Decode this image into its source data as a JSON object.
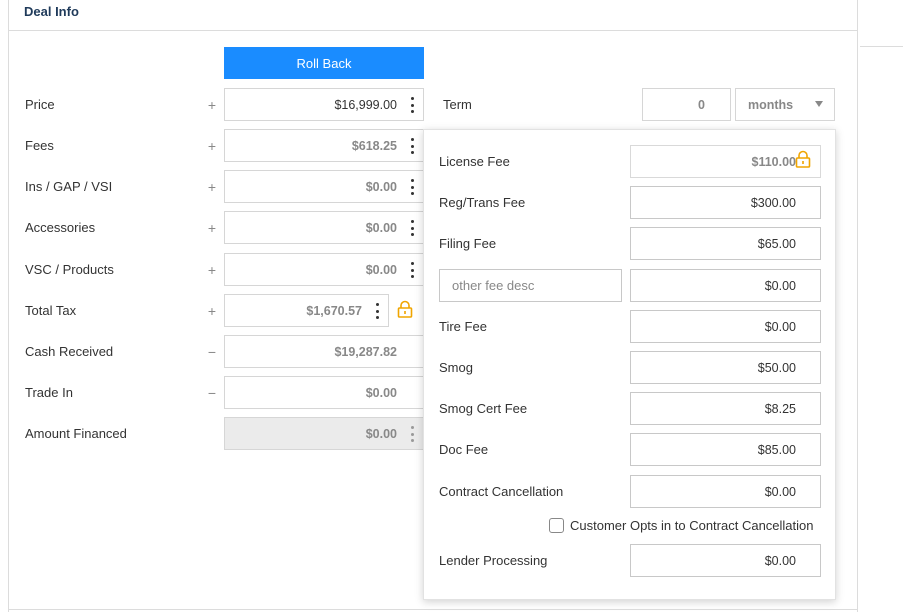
{
  "panel": {
    "title": "Deal Info"
  },
  "rollback_label": "Roll Back",
  "rows": {
    "price": {
      "label": "Price",
      "op": "+",
      "value": "$16,999.00"
    },
    "fees": {
      "label": "Fees",
      "op": "+",
      "value": "$618.25"
    },
    "ins": {
      "label": "Ins / GAP / VSI",
      "op": "+",
      "value": "$0.00"
    },
    "accessories": {
      "label": "Accessories",
      "op": "+",
      "value": "$0.00"
    },
    "vsc": {
      "label": "VSC / Products",
      "op": "+",
      "value": "$0.00"
    },
    "tax": {
      "label": "Total Tax",
      "op": "+",
      "value": "$1,670.57"
    },
    "cash": {
      "label": "Cash Received",
      "op": "−",
      "value": "$19,287.82"
    },
    "trade": {
      "label": "Trade In",
      "op": "−",
      "value": "$0.00"
    },
    "financed": {
      "label": "Amount Financed",
      "value": "$0.00"
    }
  },
  "term": {
    "label": "Term",
    "value": "0",
    "unit": "months"
  },
  "fees_popover": {
    "license": {
      "label": "License Fee",
      "value": "$110.00"
    },
    "reg": {
      "label": "Reg/Trans Fee",
      "value": "$300.00"
    },
    "filing": {
      "label": "Filing Fee",
      "value": "$65.00"
    },
    "other": {
      "placeholder": "other fee desc",
      "value": "$0.00"
    },
    "tire": {
      "label": "Tire Fee",
      "value": "$0.00"
    },
    "smog": {
      "label": "Smog",
      "value": "$50.00"
    },
    "smog_cert": {
      "label": "Smog Cert Fee",
      "value": "$8.25"
    },
    "doc": {
      "label": "Doc Fee",
      "value": "$85.00"
    },
    "contract": {
      "label": "Contract Cancellation",
      "value": "$0.00"
    },
    "opt_in_label": "Customer Opts in to Contract Cancellation",
    "lender": {
      "label": "Lender Processing",
      "value": "$0.00"
    }
  },
  "colors": {
    "accent": "#1a8cff",
    "lock": "#f0a500",
    "title": "#1f3a5a"
  },
  "icons": {
    "kebab": "kebab-menu-icon",
    "lock": "lock-icon",
    "caret": "chevron-down-icon",
    "checkbox": "checkbox-icon"
  }
}
